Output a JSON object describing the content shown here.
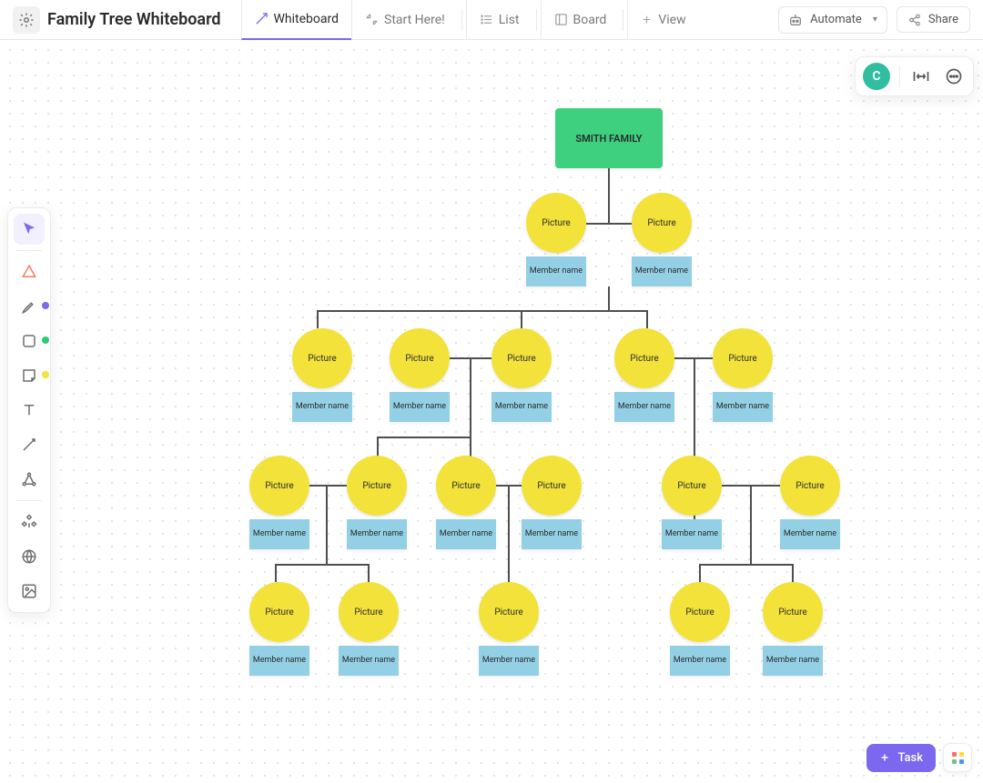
{
  "header": {
    "title": "Family Tree Whiteboard",
    "tabs": [
      {
        "label": "Whiteboard",
        "active": true
      },
      {
        "label": "Start Here!",
        "active": false
      },
      {
        "label": "List",
        "active": false
      },
      {
        "label": "Board",
        "active": false
      },
      {
        "label": "View",
        "active": false
      }
    ],
    "automate_label": "Automate",
    "share_label": "Share",
    "avatar_initial": "C"
  },
  "toolbar": {
    "color_dots": [
      "#7b68ee",
      "#2ecc71",
      "#f2e23a"
    ]
  },
  "diagram": {
    "root_label": "SMITH FAMILY",
    "picture_label": "Picture",
    "member_label": "Member name"
  },
  "bottom": {
    "task_label": "Task"
  }
}
